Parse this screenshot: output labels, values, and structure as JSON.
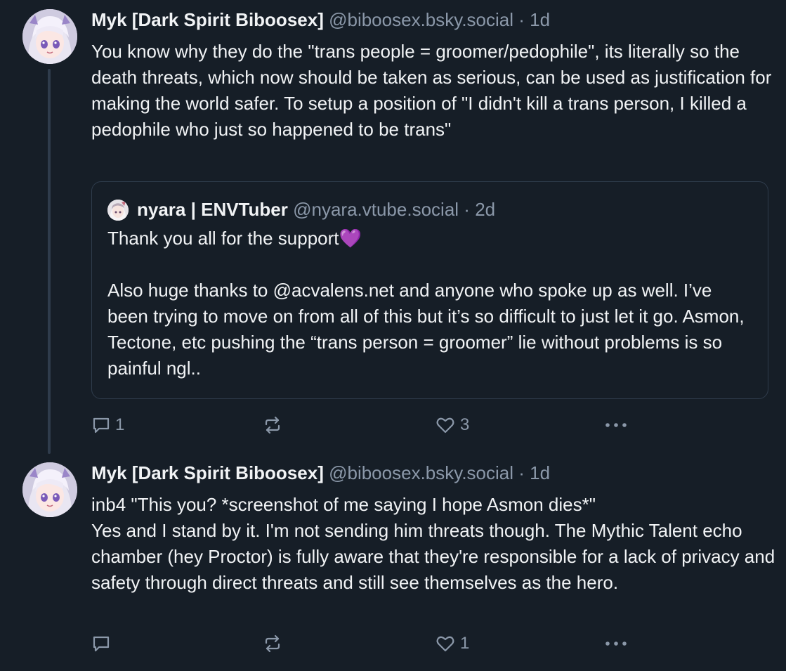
{
  "posts": [
    {
      "author_name": "Myk [Dark Spirit Biboosex]",
      "handle": "@biboosex.bsky.social",
      "separator": "·",
      "time": "1d",
      "text": "You know why they do the \"trans people = groomer/pedophile\", its literally so the death threats, which now should be taken as serious, can be used as justification for making the world safer. To setup a position of \"I didn't kill a trans person, I killed a pedophile who just so happened to be trans\"",
      "quote": {
        "author_name": "nyara | ENVTuber",
        "handle": "@nyara.vtube.social",
        "separator": "·",
        "time": "2d",
        "text_line1": "Thank you all for the support",
        "text_emoji": "💜",
        "text_rest": "Also huge thanks to @acvalens.net and anyone who spoke up as well. I’ve been trying to move on from all of this but it’s so difficult to just let it go. Asmon, Tectone, etc pushing the “trans person = groomer” lie without problems is so painful ngl.."
      },
      "reply_count": "1",
      "like_count": "3"
    },
    {
      "author_name": "Myk [Dark Spirit Biboosex]",
      "handle": "@biboosex.bsky.social",
      "separator": "·",
      "time": "1d",
      "text": "inb4 \"This you? *screenshot of me saying I hope Asmon dies*\"\nYes and I stand by it. I'm not sending him threats though. The Mythic Talent echo chamber (hey Proctor) is fully aware that they're responsible for a lack of privacy and safety through direct threats and still see themselves as the hero.",
      "reply_count": "",
      "like_count": "1"
    }
  ],
  "icons": {
    "reply": "reply-bubble-icon",
    "repost": "repost-arrows-icon",
    "like": "heart-outline-icon",
    "more": "more-dots-icon"
  },
  "colors": {
    "background": "#161e27",
    "text_primary": "#f1f3f5",
    "text_secondary": "#8b98a9",
    "border": "#2f3c4c"
  }
}
